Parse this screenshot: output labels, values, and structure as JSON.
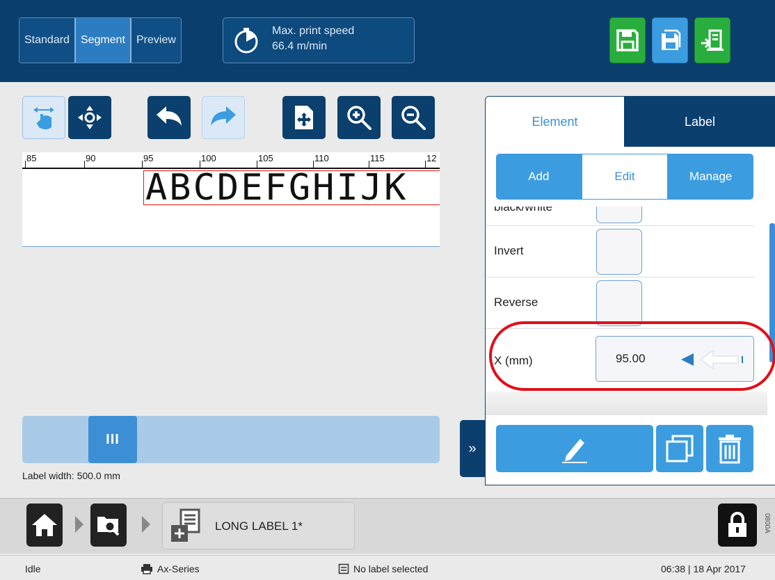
{
  "header": {
    "view_tabs": [
      "Standard",
      "Segment",
      "Preview"
    ],
    "active_view": "Segment",
    "speed_title": "Max. print speed",
    "speed_value": "66.4 m/min",
    "buttons": [
      "save-icon",
      "save-as-icon",
      "exit-icon"
    ]
  },
  "toolbar": {
    "buttons": [
      "touch-pan-icon",
      "move-icon",
      "undo-icon",
      "redo-icon",
      "fit-icon",
      "zoom-in-icon",
      "zoom-out-icon"
    ]
  },
  "editor": {
    "ruler_labels": [
      "85",
      "90",
      "95",
      "100",
      "105",
      "110",
      "115",
      "12"
    ],
    "label_text": "ABCDEFGHIJK",
    "scroll_grip": "III",
    "label_width": "Label width: 500.0 mm",
    "collapse": "»"
  },
  "panel": {
    "tabs": [
      "Element",
      "Label"
    ],
    "active_tab": "Element",
    "subtabs": [
      "Add",
      "Edit",
      "Manage"
    ],
    "active_subtab": "Edit",
    "props": {
      "black_white": "black/white",
      "invert": "Invert",
      "reverse": "Reverse",
      "x_label": "X (mm)",
      "x_value": "95.00"
    },
    "actions": [
      "edit-pencil-icon",
      "copy-icon",
      "delete-icon"
    ]
  },
  "footer": {
    "crumb_title": "LONG LABEL 1*",
    "version_code": "0800A"
  },
  "status": {
    "state": "Idle",
    "printer": "Ax-Series",
    "label": "No label selected",
    "datetime": "06:38 | 18 Apr 2017"
  },
  "colors": {
    "navy": "#0a3f6d",
    "accent_blue": "#3c9ce0",
    "green": "#29ae3e",
    "highlight_red": "#e0101a"
  }
}
